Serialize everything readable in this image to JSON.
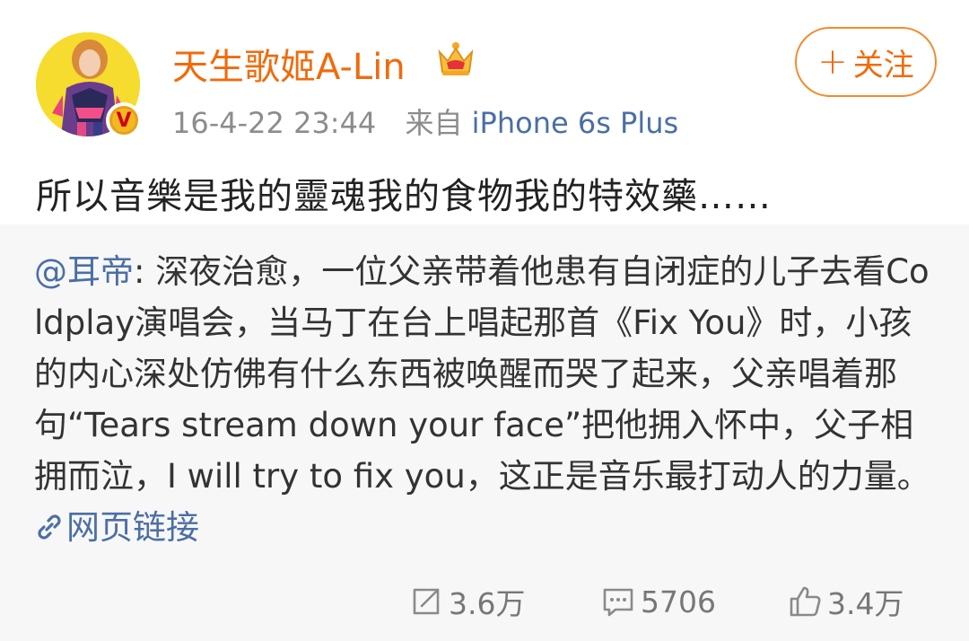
{
  "user": {
    "name": "天生歌姬A-Lin",
    "verified_mark": "V",
    "crown_icon": "crown-icon"
  },
  "post": {
    "time": "16-4-22 23:44",
    "source_prefix": "来自",
    "source": "iPhone 6s Plus",
    "text": "所以音樂是我的靈魂我的食物我的特效藥……"
  },
  "follow": {
    "plus": "+",
    "label": "关注"
  },
  "repost": {
    "mention": "@耳帝",
    "text": ": 深夜治愈，一位父亲带着他患有自闭症的儿子去看Coldplay演唱会，当马丁在台上唱起那首《Fix You》时，小孩的内心深处仿佛有什么东西被唤醒而哭了起来，父亲唱着那句“Tears stream down your face”把他拥入怀中，父子相拥而泣，I will try to fix you，这正是音乐最打动人的力量。",
    "link_label": "网页链接"
  },
  "actions": {
    "repost_count": "3.6万",
    "comment_count": "5706",
    "like_count": "3.4万"
  },
  "colors": {
    "accent": "#f06b0d",
    "link": "#4b6fa5",
    "repost_bg": "#f7f7f7"
  }
}
